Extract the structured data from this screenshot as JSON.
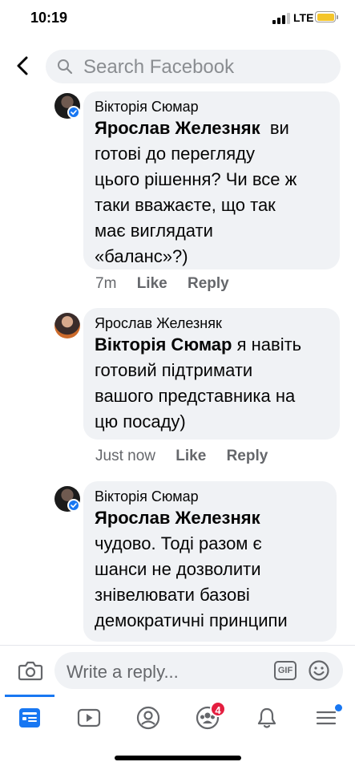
{
  "status_bar": {
    "time": "10:19",
    "network": "LTE"
  },
  "header": {
    "search_placeholder": "Search Facebook"
  },
  "comments": [
    {
      "author": "Вікторія Сюмар",
      "mention": "Ярослав Железняк",
      "text_lines": [
        "ви",
        "готові до перегляду",
        "цього рішення? Чи все ж",
        "таки вважаєте, що так",
        "має виглядати",
        "«баланс»?)"
      ],
      "time": "7m",
      "like_label": "Like",
      "reply_label": "Reply",
      "verified": true
    },
    {
      "author": "Ярослав Железняк",
      "mention": "Вікторія Сюмар",
      "text_lines": [
        "я навіть",
        "готовий підтримати",
        "вашого представника на",
        "цю посаду)"
      ],
      "time": "Just now",
      "like_label": "Like",
      "reply_label": "Reply",
      "verified": false
    },
    {
      "author": "Вікторія Сюмар",
      "mention": "Ярослав Железняк",
      "text_lines": [
        "чудово. Тоді разом є",
        "шанси не дозволити",
        "знівелювати базові",
        "демократичні принципи"
      ],
      "verified": true
    }
  ],
  "reply_bar": {
    "placeholder": "Write a reply...",
    "gif_label": "GIF"
  },
  "tab_bar": {
    "tabs": [
      {
        "name": "news-feed-icon",
        "active": true
      },
      {
        "name": "watch-icon",
        "active": false
      },
      {
        "name": "profile-icon",
        "active": false
      },
      {
        "name": "groups-icon",
        "active": false,
        "badge": "4"
      },
      {
        "name": "notifications-bell-icon",
        "active": false
      },
      {
        "name": "menu-icon",
        "active": false,
        "dot": true
      }
    ]
  },
  "colors": {
    "accent": "#1877f2",
    "bubble": "#f0f2f5",
    "meta_text": "#65676b",
    "badge_red": "#e41e3f"
  }
}
